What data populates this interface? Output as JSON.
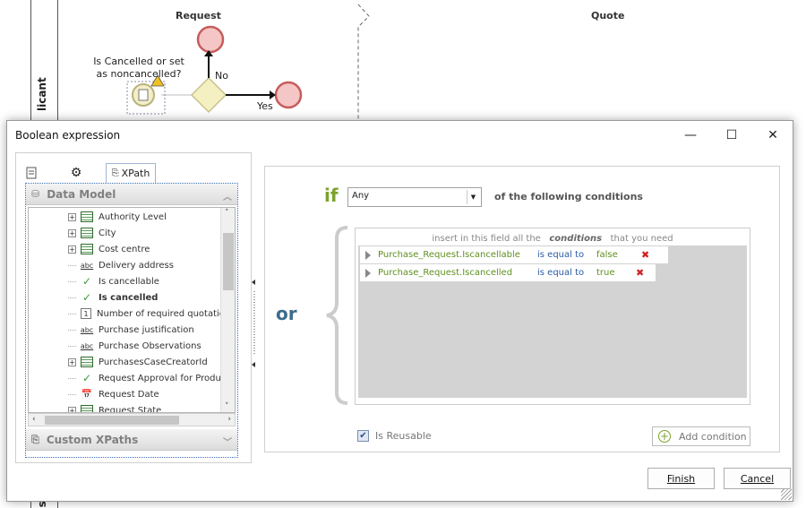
{
  "canvas": {
    "lanes": {
      "request_header": "Request",
      "quote_header": "Quote",
      "side_label_top": "licant",
      "side_label_bottom": "sch"
    },
    "gateway_question": "Is Cancelled or set as noncancelled?",
    "flow_no": "No",
    "flow_yes": "Yes"
  },
  "dialog": {
    "title": "Boolean expression",
    "window_buttons": {
      "minimize": "—",
      "maximize": "☐",
      "close": "✕"
    },
    "left": {
      "tabs": [
        {
          "icon": "document-icon"
        },
        {
          "icon": "gear-icon"
        },
        {
          "label": "XPath",
          "icon": "xpath-icon"
        }
      ],
      "data_model_header": "Data Model",
      "custom_xpaths_header": "Custom XPaths",
      "tree": [
        {
          "label": "Authority Level",
          "icon": "table",
          "expand": "+"
        },
        {
          "label": "City",
          "icon": "table",
          "expand": "+"
        },
        {
          "label": "Cost centre",
          "icon": "table",
          "expand": "+"
        },
        {
          "label": "Delivery address",
          "icon": "abc"
        },
        {
          "label": "Is cancellable",
          "icon": "check"
        },
        {
          "label": "Is cancelled",
          "icon": "check",
          "bold": true
        },
        {
          "label": "Number of required quotatio",
          "icon": "number"
        },
        {
          "label": "Purchase justification",
          "icon": "abc"
        },
        {
          "label": "Purchase Observations",
          "icon": "abc"
        },
        {
          "label": "PurchasesCaseCreatorId",
          "icon": "table",
          "expand": "+"
        },
        {
          "label": "Request Approval for Produc",
          "icon": "check"
        },
        {
          "label": "Request Date",
          "icon": "date"
        },
        {
          "label": "Request State",
          "icon": "table",
          "expand": "+"
        }
      ]
    },
    "right": {
      "if_label": "if",
      "quantifier_value": "Any",
      "following_label": "of the following conditions",
      "or_label": "or",
      "hint_before": "insert in this field all the",
      "hint_keyword": "conditions",
      "hint_after": "that you need",
      "conditions": [
        {
          "field": "Purchase_Request.Iscancellable",
          "operator": "is equal to",
          "value": "false"
        },
        {
          "field": "Purchase_Request.Iscancelled",
          "operator": "is equal to",
          "value": "true"
        }
      ],
      "delete_glyph": "✖",
      "is_reusable_label": "Is Reusable",
      "is_reusable_checked": true,
      "add_condition_label": "Add condition"
    },
    "finish_label": "Finish",
    "cancel_label": "Cancel"
  },
  "colors": {
    "accent_green": "#7aa32a",
    "or_blue": "#3d6b8a",
    "operator_blue": "#2a5ea8",
    "delete_red": "#d02020",
    "gateway_yellow": "#f5f0c2"
  }
}
